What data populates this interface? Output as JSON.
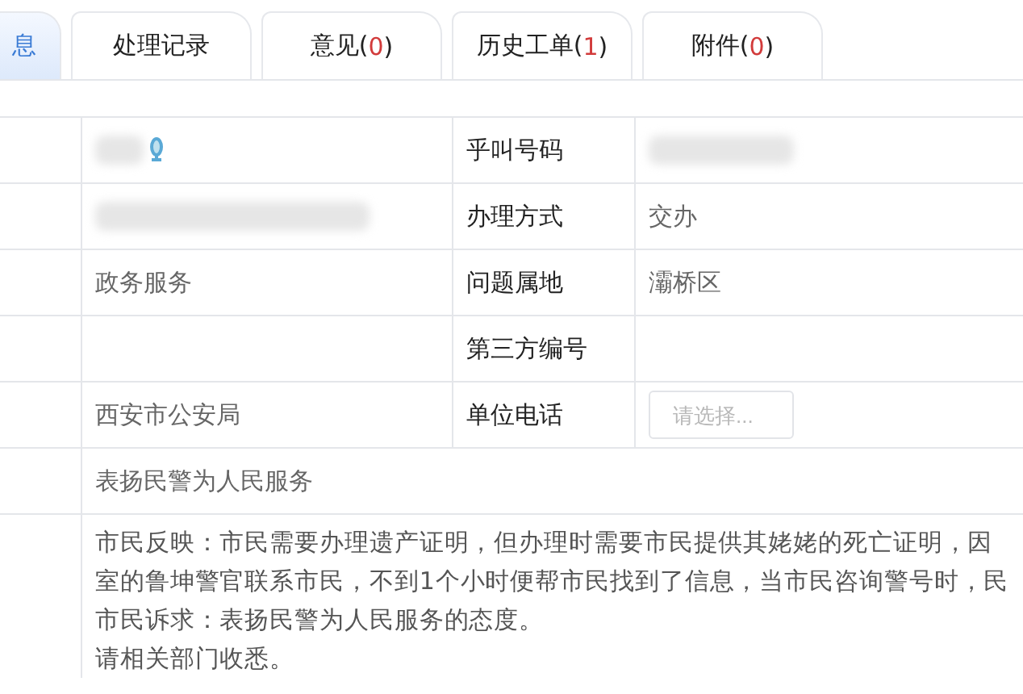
{
  "tabs": [
    {
      "parts": [
        {
          "text": "息",
          "kind": "plain"
        }
      ],
      "selected": true
    },
    {
      "parts": [
        {
          "text": "处理记录",
          "kind": "plain"
        }
      ],
      "selected": false
    },
    {
      "parts": [
        {
          "text": "意见(",
          "kind": "plain"
        },
        {
          "text": "0",
          "kind": "count"
        },
        {
          "text": ")",
          "kind": "plain"
        }
      ],
      "selected": false
    },
    {
      "parts": [
        {
          "text": "历史工单(",
          "kind": "plain"
        },
        {
          "text": "1",
          "kind": "count"
        },
        {
          "text": ")",
          "kind": "plain"
        }
      ],
      "selected": false
    },
    {
      "parts": [
        {
          "text": "附件(",
          "kind": "plain"
        },
        {
          "text": "0",
          "kind": "count"
        },
        {
          "text": ")",
          "kind": "plain"
        }
      ],
      "selected": false
    }
  ],
  "rows": [
    {
      "cells": [
        {
          "kind": "redacted-icon"
        },
        {
          "kind": "label",
          "text": "乎叫号码"
        },
        {
          "kind": "redacted"
        }
      ]
    },
    {
      "cells": [
        {
          "kind": "redacted"
        },
        {
          "kind": "label",
          "text": "办理方式"
        },
        {
          "kind": "value",
          "text": "交办"
        }
      ]
    },
    {
      "cells": [
        {
          "kind": "value",
          "text": "政务服务"
        },
        {
          "kind": "label",
          "text": "问题属地"
        },
        {
          "kind": "value",
          "text": "灞桥区"
        }
      ]
    },
    {
      "cells": [
        {
          "kind": "empty"
        },
        {
          "kind": "label",
          "text": "第三方编号"
        },
        {
          "kind": "empty"
        }
      ]
    },
    {
      "cells": [
        {
          "kind": "value",
          "text": "西安市公安局"
        },
        {
          "kind": "label",
          "text": "单位电话"
        },
        {
          "kind": "select",
          "placeholder": "请选择..."
        }
      ]
    }
  ],
  "title_row": "表扬民警为人民服务",
  "content_lines": [
    "市民反映：市民需要办理遗产证明，但办理时需要市民提供其姥姥的死亡证明，因",
    "室的鲁坤警官联系市民，不到1个小时便帮市民找到了信息，当市民咨询警号时，民",
    "市民诉求：表扬民警为人民服务的态度。",
    "请相关部门收悉。"
  ]
}
